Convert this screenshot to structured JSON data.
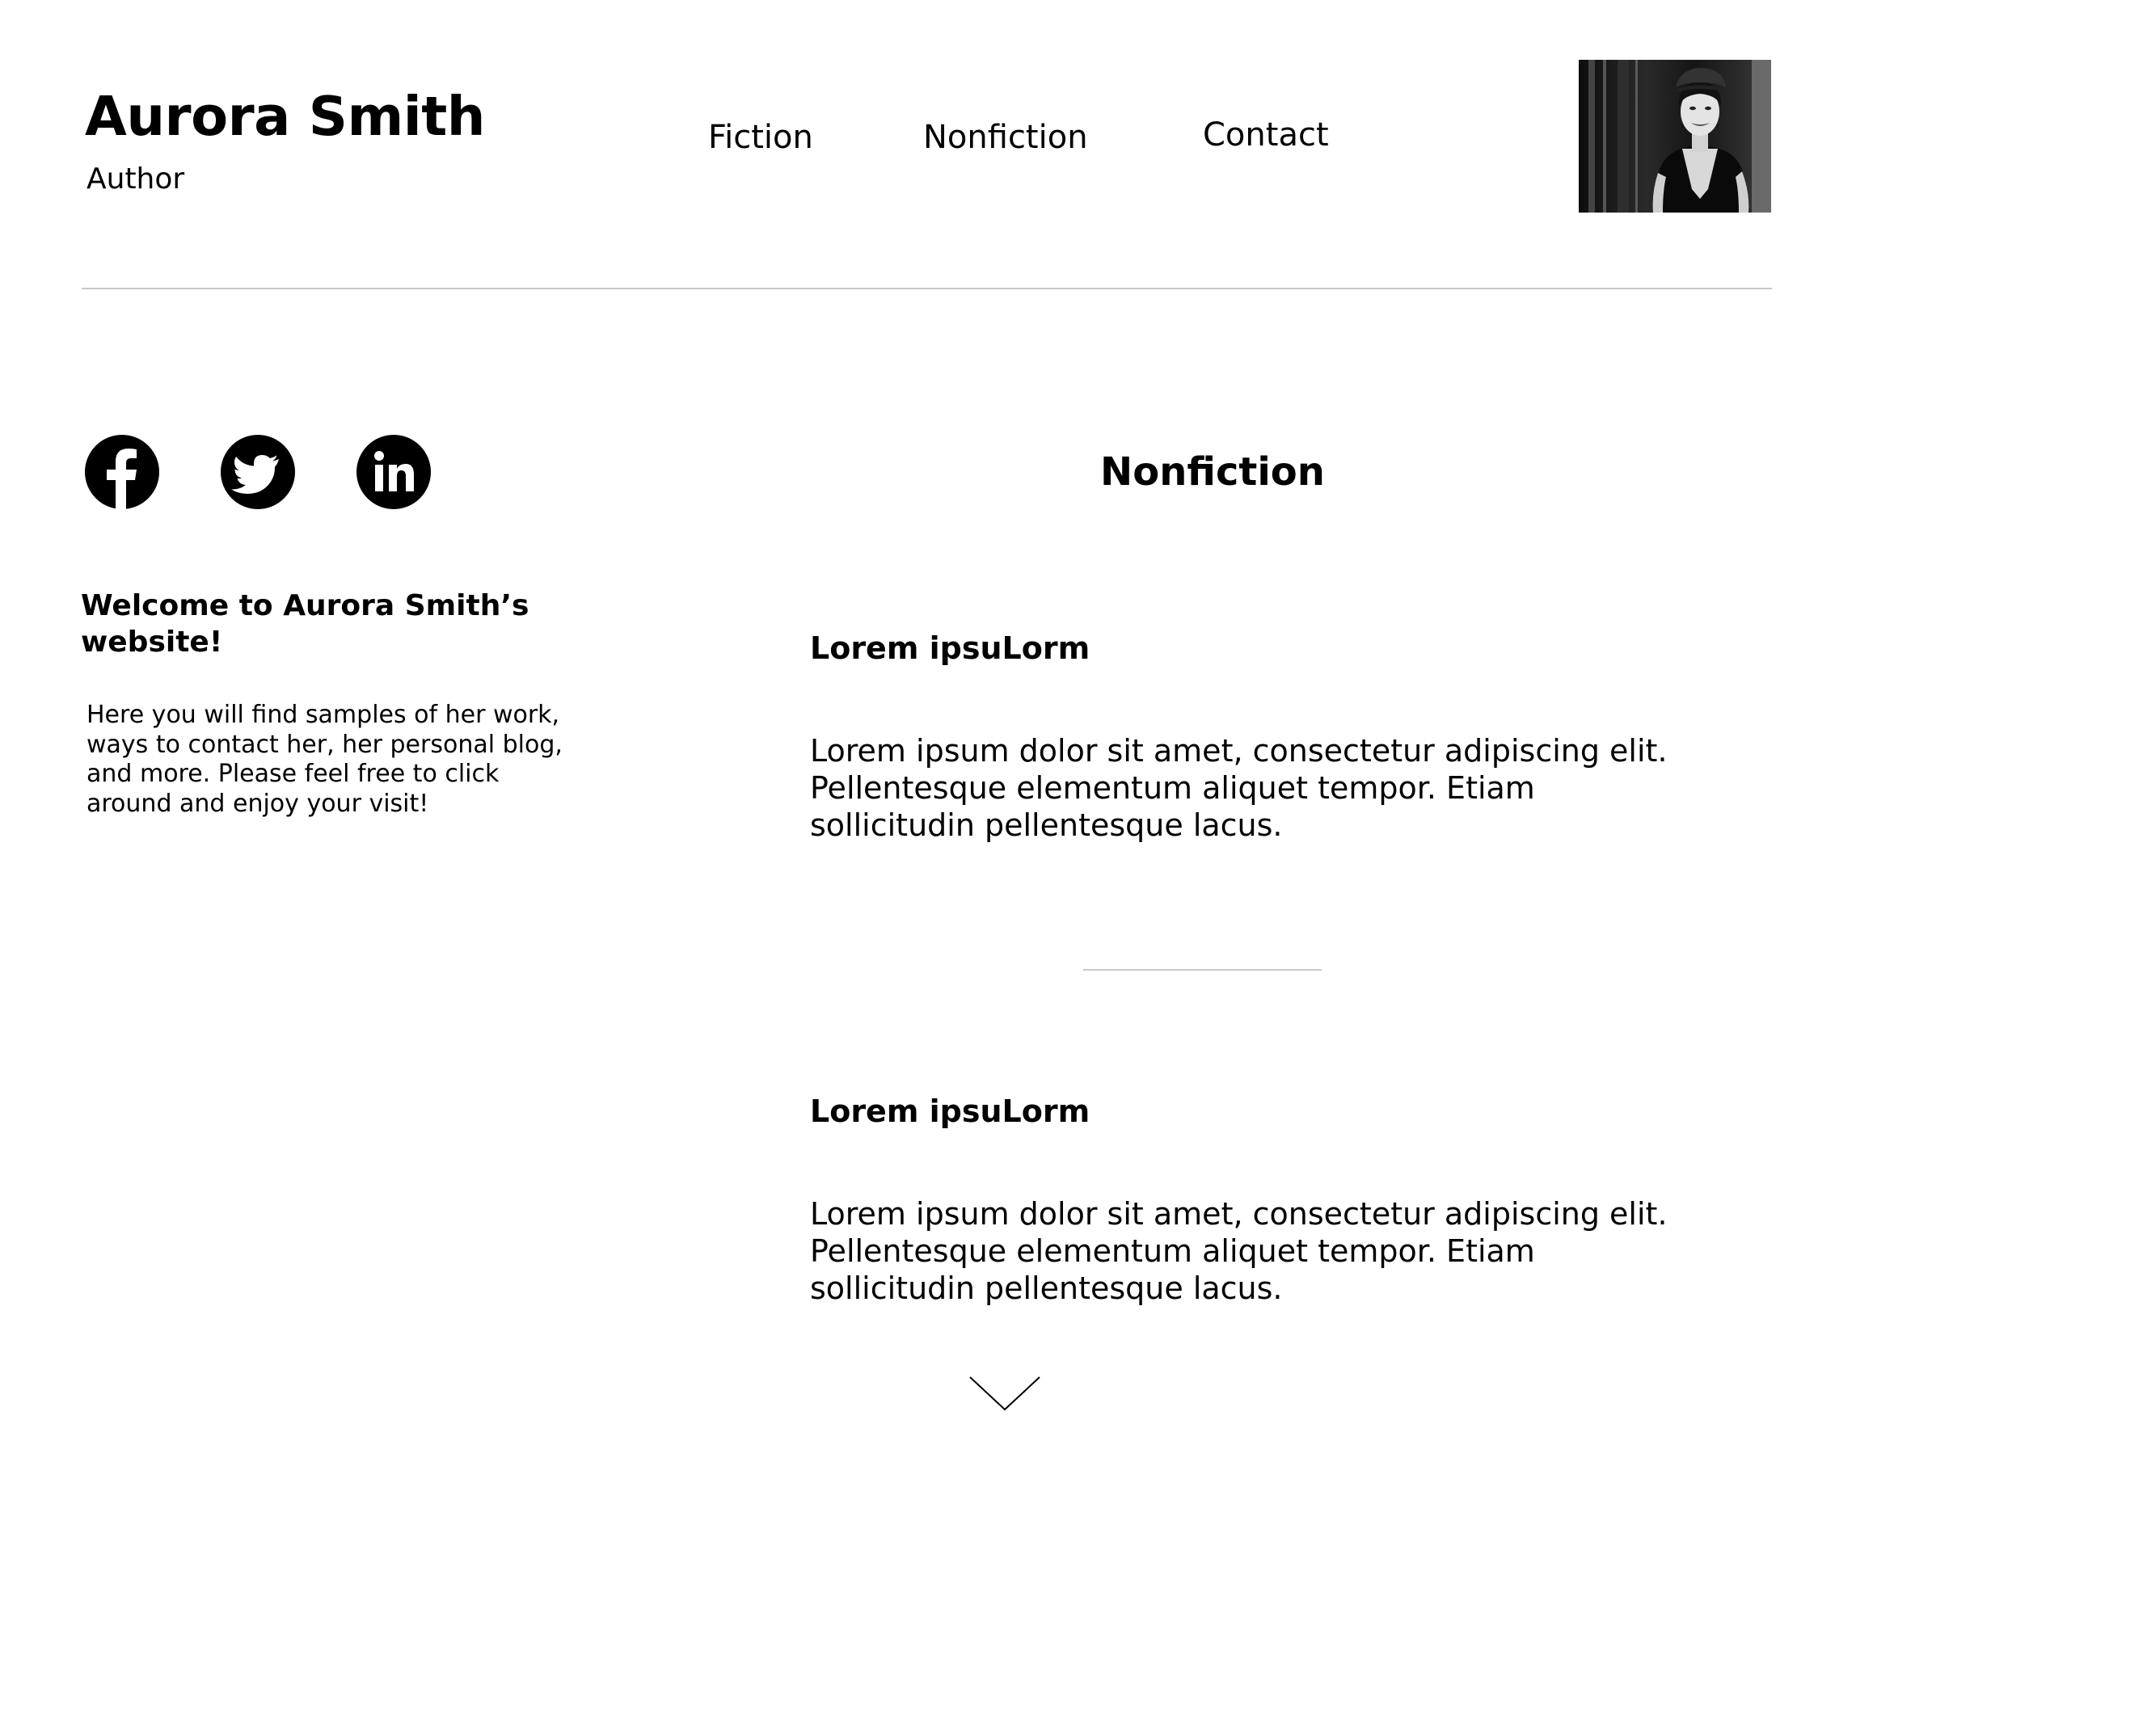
{
  "header": {
    "site_title": "Aurora Smith",
    "site_subtitle": "Author",
    "nav": [
      {
        "label": "Fiction"
      },
      {
        "label": "Nonfiction"
      },
      {
        "label": "Contact"
      }
    ],
    "portrait_alt": "author-portrait"
  },
  "social": {
    "icons": [
      "facebook-icon",
      "twitter-icon",
      "linkedin-icon"
    ]
  },
  "sidebar": {
    "welcome_title": "Welcome to Aurora Smith’s website!",
    "welcome_text": "Here you will find samples of her work, ways to contact her, her personal blog, and more. Please feel free to click around and enjoy your visit!"
  },
  "main": {
    "section_title": "Nonfiction",
    "articles": [
      {
        "title": "Lorem ipsuLorm",
        "body": "Lorem ipsum dolor sit amet, consectetur adipiscing elit. Pellentesque elementum aliquet tempor. Etiam sollicitudin pellentesque lacus."
      },
      {
        "title": "Lorem ipsuLorm",
        "body": "Lorem ipsum dolor sit amet, consectetur adipiscing elit. Pellentesque elementum aliquet tempor. Etiam sollicitudin pellentesque lacus."
      }
    ],
    "scroll_icon": "chevron-down-icon"
  },
  "colors": {
    "text": "#000000",
    "rule": "#c8c8c8",
    "background": "#ffffff"
  }
}
